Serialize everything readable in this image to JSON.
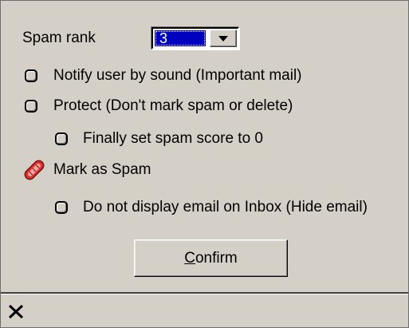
{
  "spam_rank": {
    "label": "Spam rank",
    "selected_value": "3"
  },
  "options": {
    "notify_sound": {
      "label": "Notify user by sound (Important mail)",
      "checked": false
    },
    "protect": {
      "label": "Protect (Don't mark spam or delete)",
      "checked": false
    },
    "finally_zero": {
      "label": "Finally set spam score to 0",
      "checked": false
    },
    "mark_spam": {
      "label": "Mark as Spam",
      "icon": "spam-stamp-icon"
    },
    "hide_email": {
      "label": "Do not display email on Inbox (Hide email)",
      "checked": false
    }
  },
  "confirm_button": {
    "label_underlined": "C",
    "label_rest": "onfirm"
  },
  "status_bar": {
    "close_icon": "close-icon"
  },
  "colors": {
    "background": "#d4d0c8",
    "selection": "#0000c0",
    "stamp": "#e0312f"
  }
}
